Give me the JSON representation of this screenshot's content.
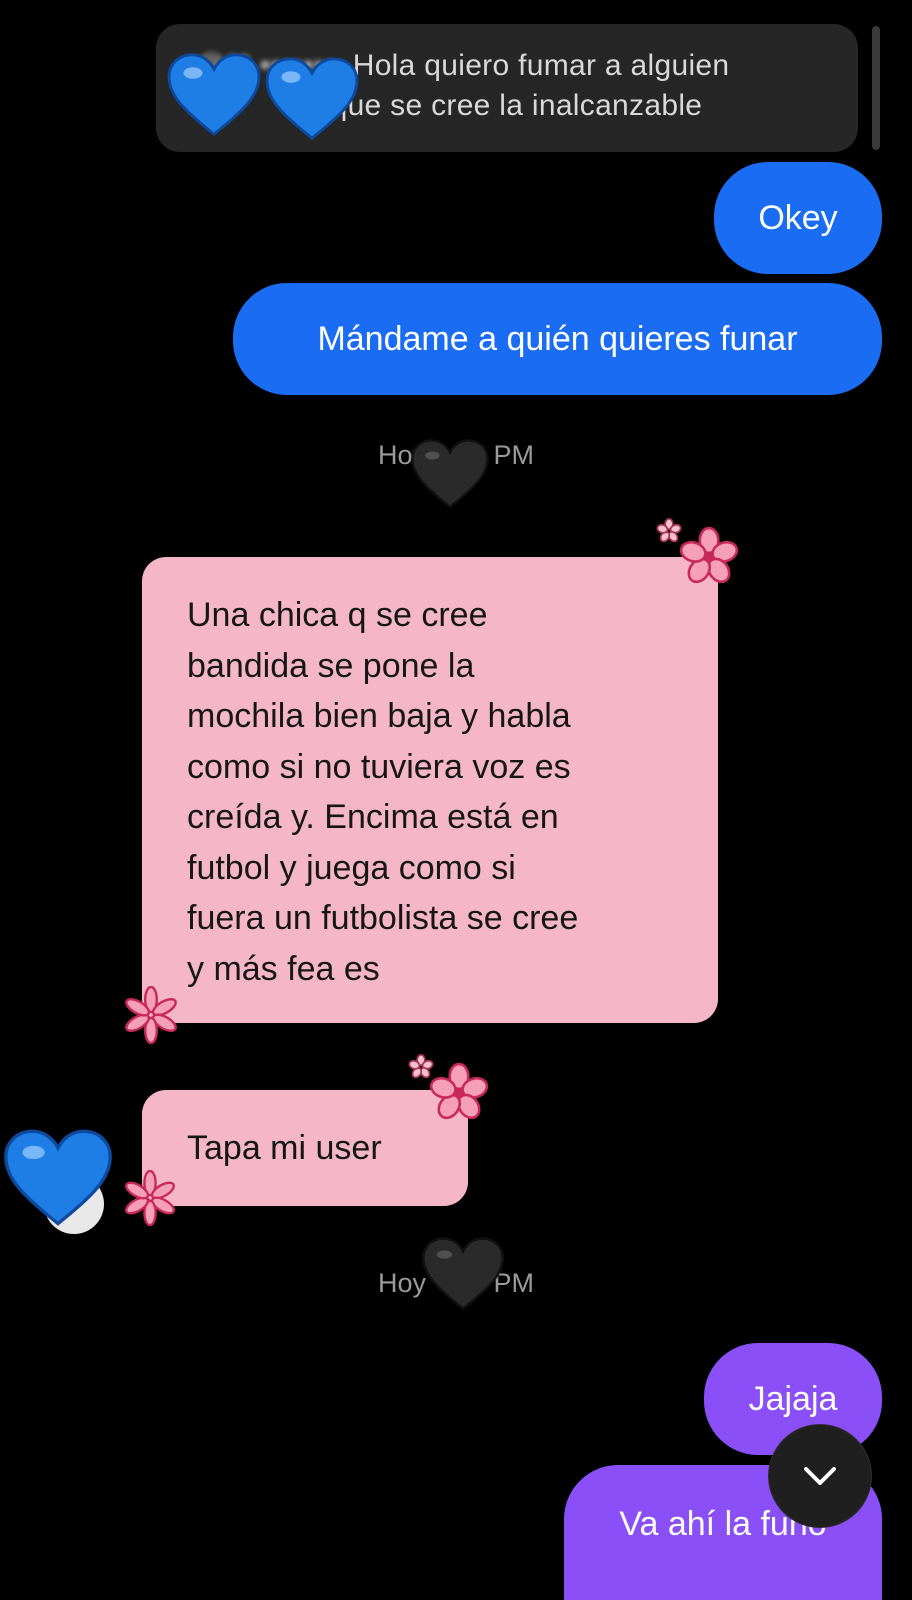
{
  "quoted_reply": {
    "sender_obscured": "@❤ •••••••",
    "line1": ": Hola quiero fumar a alguien",
    "line2": "mi         n que se cree la inalcanzable"
  },
  "messages": {
    "okey": "Okey",
    "mandame": "Mándame a quién quieres funar",
    "timestamp1": "Hoy         PM",
    "long_lines": [
      "Una chica q se cree",
      "bandida se pone la",
      "mochila bien baja y habla",
      "como si no tuviera voz es",
      "creída y. Encima está en",
      "futbol y juega como si",
      "fuera un futbolista se cree",
      "y más fea es"
    ],
    "tapa": "Tapa mi user",
    "timestamp2": "Hoy         PM",
    "jajaja": "Jajaja",
    "vaahi": "Va ahí la funo"
  },
  "colors": {
    "outgoing_blue": "#1a6df2",
    "incoming_pink": "#f5b6c7",
    "outgoing_purple": "#8a4ff7",
    "quoted_bg": "#262626",
    "blue_heart": "#1e7ee6",
    "black_heart": "#2a2a2a",
    "flower": "#d2335f"
  },
  "icons": {
    "scroll_down": "chevron-down-icon",
    "blue_heart": "blue-heart-sticker",
    "black_heart": "black-heart-sticker",
    "flower": "flower-sticker"
  }
}
